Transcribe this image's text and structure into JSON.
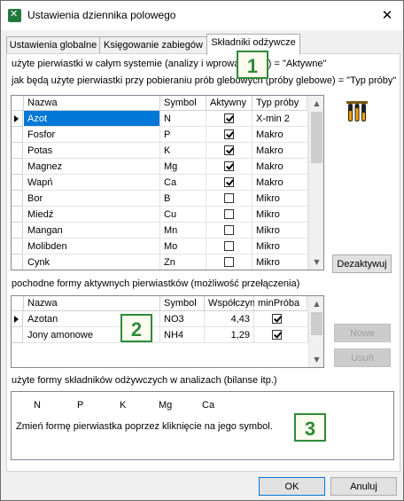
{
  "window": {
    "title": "Ustawienia dziennika polowego"
  },
  "tabs": [
    {
      "label": "Ustawienia globalne",
      "active": false
    },
    {
      "label": "Księgowanie zabiegów",
      "active": false
    },
    {
      "label": "Składniki odżywcze",
      "active": true
    }
  ],
  "section1": {
    "line1": "użyte pierwiastki w całym systemie (analizy i wprowadzanie) = \"Aktywne\"",
    "line2": "jak będą użyte pierwiastki przy pobieraniu prób glebowych (próby glebowe) = \"Typ próby\"",
    "columns": [
      "Nazwa",
      "Symbol",
      "Aktywny",
      "Typ próby"
    ],
    "rows": [
      {
        "name": "Azot",
        "symbol": "N",
        "active": true,
        "type": "X-min 2",
        "selected": true
      },
      {
        "name": "Fosfor",
        "symbol": "P",
        "active": true,
        "type": "Makro"
      },
      {
        "name": "Potas",
        "symbol": "K",
        "active": true,
        "type": "Makro"
      },
      {
        "name": "Magnez",
        "symbol": "Mg",
        "active": true,
        "type": "Makro"
      },
      {
        "name": "Wapń",
        "symbol": "Ca",
        "active": true,
        "type": "Makro"
      },
      {
        "name": "Bor",
        "symbol": "B",
        "active": false,
        "type": "Mikro"
      },
      {
        "name": "Miedź",
        "symbol": "Cu",
        "active": false,
        "type": "Mikro"
      },
      {
        "name": "Mangan",
        "symbol": "Mn",
        "active": false,
        "type": "Mikro"
      },
      {
        "name": "Molibden",
        "symbol": "Mo",
        "active": false,
        "type": "Mikro"
      },
      {
        "name": "Cynk",
        "symbol": "Zn",
        "active": false,
        "type": "Mikro"
      }
    ],
    "deactivate_button": "Dezaktywuj",
    "image_icon": "test-tubes-icon"
  },
  "section2": {
    "label": "pochodne formy aktywnych pierwiastków (możliwość przełączenia)",
    "columns": [
      "Nazwa",
      "Symbol",
      "Współczynnik",
      "minPróba"
    ],
    "rows": [
      {
        "name": "Azotan",
        "symbol": "NO3",
        "factor": "4,43",
        "min": true,
        "selected": true
      },
      {
        "name": "Jony amonowe",
        "symbol": "NH4",
        "factor": "1,29",
        "min": true
      }
    ],
    "new_button": "Nowe",
    "delete_button": "Usuń"
  },
  "section3": {
    "label": "użyte formy składników odżywczych w analizach (bilanse itp.)",
    "symbols": [
      "N",
      "P",
      "K",
      "Mg",
      "Ca"
    ],
    "hint": "Zmień formę pierwiastka poprzez kliknięcie na jego symbol."
  },
  "callouts": [
    "1",
    "2",
    "3"
  ],
  "footer": {
    "ok": "OK",
    "cancel": "Anuluj"
  },
  "colors": {
    "accent": "#0078d7",
    "callout_border": "#2e8b3a",
    "callout_bg": "#fdfcef"
  }
}
